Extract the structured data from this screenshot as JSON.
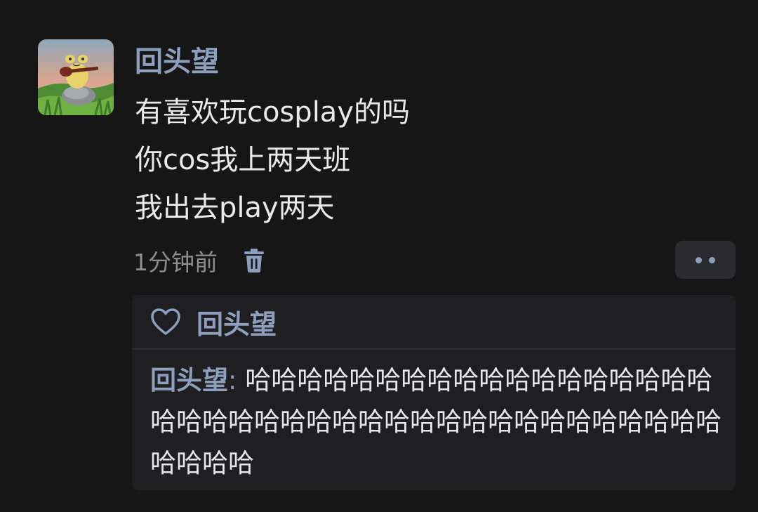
{
  "post": {
    "author": "回头望",
    "avatar_icon": "frog-ukulele-avatar-icon",
    "message_lines": [
      "有喜欢玩cosplay的吗",
      "你cos我上两天班",
      "我出去play两天"
    ],
    "timestamp": "1分钟前",
    "delete_icon": "trash-icon",
    "more_icon": "more-dots-icon"
  },
  "likes": {
    "icon": "heart-outline-icon",
    "names": "回头望"
  },
  "reply": {
    "author": "回头望",
    "separator": ": ",
    "text": "哈哈哈哈哈哈哈哈哈哈哈哈哈哈哈哈哈哈哈哈哈哈哈哈哈哈哈哈哈哈哈哈哈哈哈哈哈哈哈哈哈哈哈哈"
  },
  "colors": {
    "background": "#161616",
    "accent_name": "#8e9fbd",
    "text_primary": "#e9e9e9",
    "text_secondary": "#8d8d8d",
    "panel": "#1f1f22"
  }
}
